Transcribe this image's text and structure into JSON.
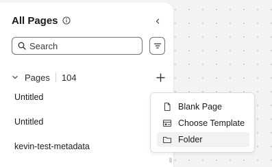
{
  "sidebar": {
    "title": "All Pages",
    "search_placeholder": "Search",
    "section": {
      "label": "Pages",
      "count": "104"
    },
    "pages": [
      "Untitled",
      "Untitled",
      "kevin-test-metadata"
    ]
  },
  "new_menu": {
    "items": [
      {
        "label": "Blank Page",
        "icon": "page-icon"
      },
      {
        "label": "Choose Template",
        "icon": "template-icon"
      },
      {
        "label": "Folder",
        "icon": "folder-icon"
      }
    ],
    "highlighted_index": 2
  },
  "icons": {
    "title_info": "info-icon",
    "collapse": "chevron-left-icon",
    "search": "search-icon",
    "filter": "filter-icon",
    "section_toggle": "chevron-down-icon",
    "add": "plus-icon"
  }
}
